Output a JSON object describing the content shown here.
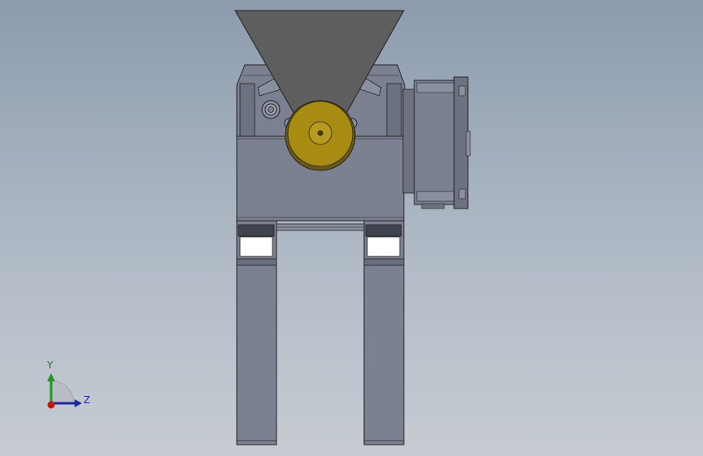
{
  "viewport": {
    "background_top": "#8c9bae",
    "background_bottom": "#c7ccd2"
  },
  "model": {
    "body_color": "#7c8191",
    "hopper_color": "#5e5e5e",
    "gear_color": "#a88c12",
    "outline_color": "#222222"
  },
  "triad": {
    "y_label": "Y",
    "z_label": "Z",
    "y_color": "#1a9a1a",
    "z_color": "#1a2aa0",
    "x_color": "#cc1111"
  }
}
